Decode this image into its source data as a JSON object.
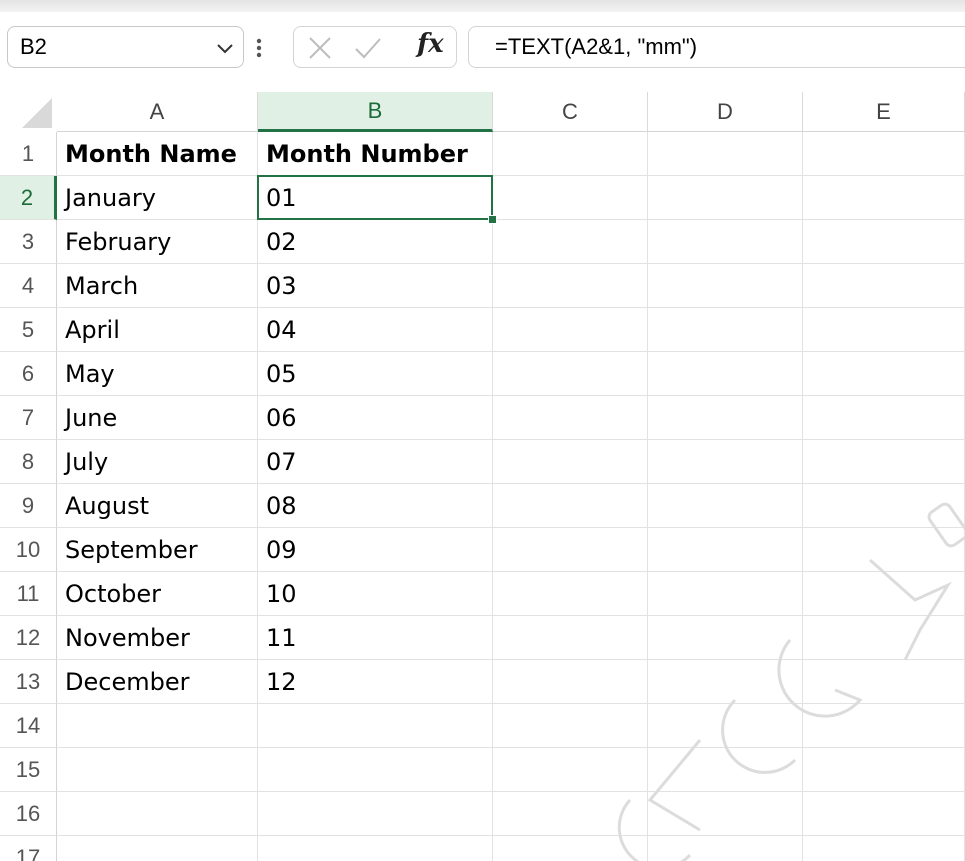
{
  "formula_bar": {
    "name_box": "B2",
    "formula": "=TEXT(A2&1, \"mm\")",
    "fx_label": "fx"
  },
  "columns": [
    "A",
    "B",
    "C",
    "D",
    "E"
  ],
  "rows": [
    {
      "num": "1",
      "a": "Month Name",
      "b": "Month Number"
    },
    {
      "num": "2",
      "a": "January",
      "b": "01"
    },
    {
      "num": "3",
      "a": "February",
      "b": "02"
    },
    {
      "num": "4",
      "a": "March",
      "b": "03"
    },
    {
      "num": "5",
      "a": "April",
      "b": "04"
    },
    {
      "num": "6",
      "a": "May",
      "b": "05"
    },
    {
      "num": "7",
      "a": "June",
      "b": "06"
    },
    {
      "num": "8",
      "a": "July",
      "b": "07"
    },
    {
      "num": "9",
      "a": "August",
      "b": "08"
    },
    {
      "num": "10",
      "a": "September",
      "b": "09"
    },
    {
      "num": "11",
      "a": "October",
      "b": "10"
    },
    {
      "num": "12",
      "a": "November",
      "b": "11"
    },
    {
      "num": "13",
      "a": "December",
      "b": "12"
    },
    {
      "num": "14",
      "a": "",
      "b": ""
    },
    {
      "num": "15",
      "a": "",
      "b": ""
    },
    {
      "num": "16",
      "a": "",
      "b": ""
    },
    {
      "num": "17",
      "a": "",
      "b": ""
    }
  ],
  "selected_cell": {
    "col": "B",
    "row": "2"
  },
  "colors": {
    "accent": "#217346",
    "watermark": "#dcdcdc"
  }
}
